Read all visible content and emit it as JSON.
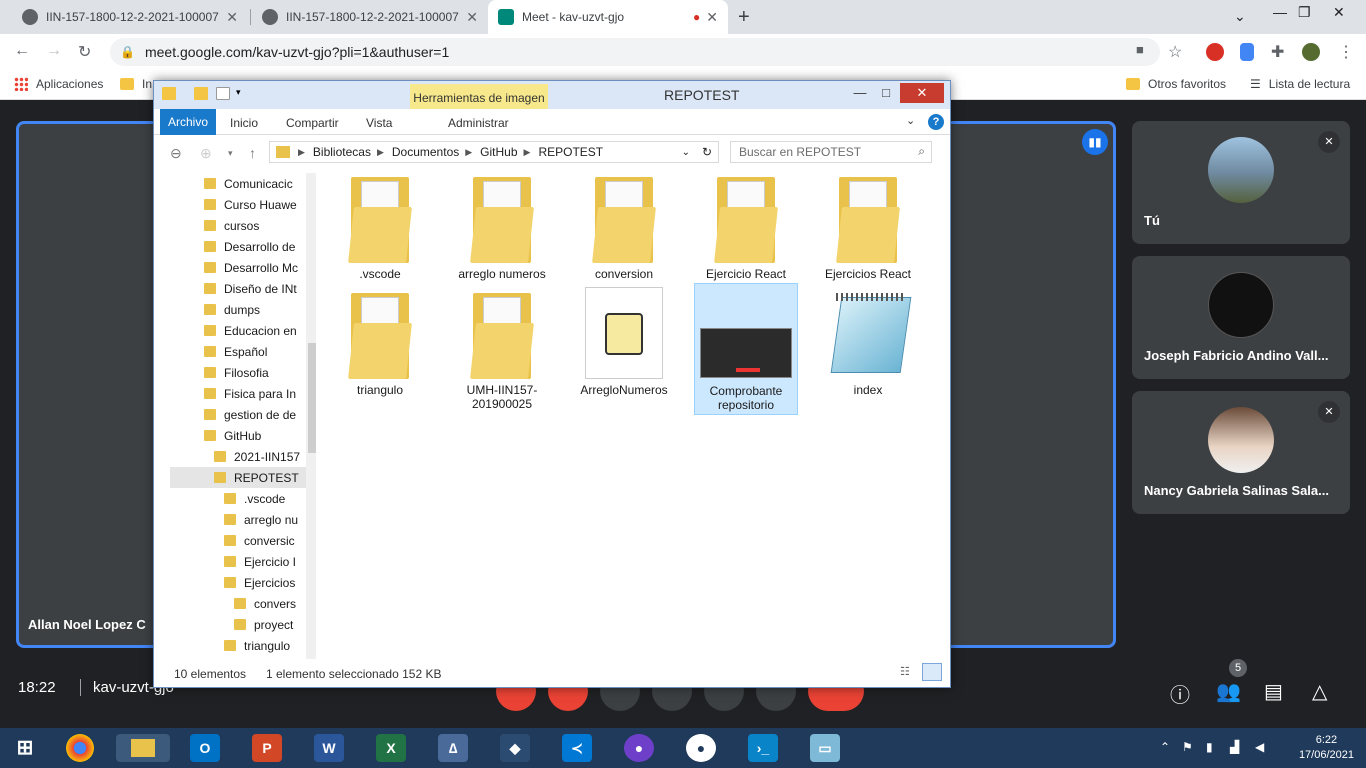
{
  "browser": {
    "tabs": [
      {
        "title": "IIN-157-1800-12-2-2021-100007"
      },
      {
        "title": "IIN-157-1800-12-2-2021-100007"
      },
      {
        "title": "Meet - kav-uzvt-gjo"
      }
    ],
    "url": "meet.google.com/kav-uzvt-gjo?pli=1&authuser=1",
    "bookmarks": {
      "apps": "Aplicaciones",
      "folder1": "In",
      "otros": "Otros favoritos",
      "lectura": "Lista de lectura"
    }
  },
  "meet": {
    "main_name": "Allan Noel Lopez C",
    "participants": [
      {
        "name": "Tú"
      },
      {
        "name": "Joseph Fabricio Andino Vall..."
      },
      {
        "name": "Nancy Gabriela Salinas Sala..."
      }
    ],
    "time": "18:22",
    "code": "kav-uzvt-gjo",
    "people_count": "5"
  },
  "explorer": {
    "title": "REPOTEST",
    "context_tab": "Herramientas de imagen",
    "ribbon": [
      "Archivo",
      "Inicio",
      "Compartir",
      "Vista",
      "Administrar"
    ],
    "path": [
      "Bibliotecas",
      "Documentos",
      "GitHub",
      "REPOTEST"
    ],
    "search_placeholder": "Buscar en REPOTEST",
    "nav_items": [
      {
        "label": "Comunicacic",
        "level": 0
      },
      {
        "label": "Curso Huawe",
        "level": 0
      },
      {
        "label": "cursos",
        "level": 0
      },
      {
        "label": "Desarrollo de",
        "level": 0
      },
      {
        "label": "Desarrollo Mc",
        "level": 0
      },
      {
        "label": "Diseño de INt",
        "level": 0
      },
      {
        "label": "dumps",
        "level": 0
      },
      {
        "label": "Educacion en",
        "level": 0
      },
      {
        "label": "Español",
        "level": 0
      },
      {
        "label": "Filosofia",
        "level": 0
      },
      {
        "label": "Fisica para In",
        "level": 0
      },
      {
        "label": "gestion de de",
        "level": 0
      },
      {
        "label": "GitHub",
        "level": 0
      },
      {
        "label": "2021-IIN157",
        "level": 1
      },
      {
        "label": "REPOTEST",
        "level": 1
      },
      {
        "label": ".vscode",
        "level": 2
      },
      {
        "label": "arreglo nu",
        "level": 2
      },
      {
        "label": "conversic",
        "level": 2
      },
      {
        "label": "Ejercicio I",
        "level": 2
      },
      {
        "label": "Ejercicios",
        "level": 2
      },
      {
        "label": "convers",
        "level": 3
      },
      {
        "label": "proyect",
        "level": 3
      },
      {
        "label": "triangulo",
        "level": 2
      }
    ],
    "items": [
      {
        "label": ".vscode",
        "kind": "folder"
      },
      {
        "label": "arreglo numeros",
        "kind": "folder"
      },
      {
        "label": "conversion",
        "kind": "folder"
      },
      {
        "label": "Ejercicio React",
        "kind": "folder"
      },
      {
        "label": "Ejercicios React",
        "kind": "folder"
      },
      {
        "label": "triangulo",
        "kind": "folder"
      },
      {
        "label": "UMH-IIN157-201900025",
        "kind": "folder"
      },
      {
        "label": "ArregloNumeros",
        "kind": "script"
      },
      {
        "label": "Comprobante repositorio",
        "kind": "image"
      },
      {
        "label": "index",
        "kind": "notepad"
      }
    ],
    "status_count": "10 elementos",
    "status_selected": "1 elemento seleccionado  152 KB"
  },
  "taskbar": {
    "time": "6:22",
    "date": "17/06/2021"
  }
}
